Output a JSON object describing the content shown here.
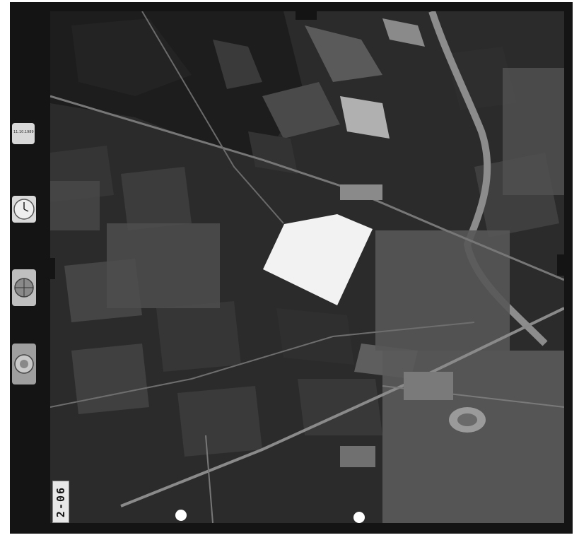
{
  "frame": {
    "number": "2-06",
    "counter_text": "11.10.1989"
  },
  "instruments": {
    "clock_icon": "clock-icon",
    "level_icon": "bubble-level-icon",
    "altimeter_icon": "altimeter-icon"
  },
  "colors": {
    "film_border": "#141414",
    "photo_base": "#2c2c2c",
    "masked_area": "#f2f2f2"
  }
}
